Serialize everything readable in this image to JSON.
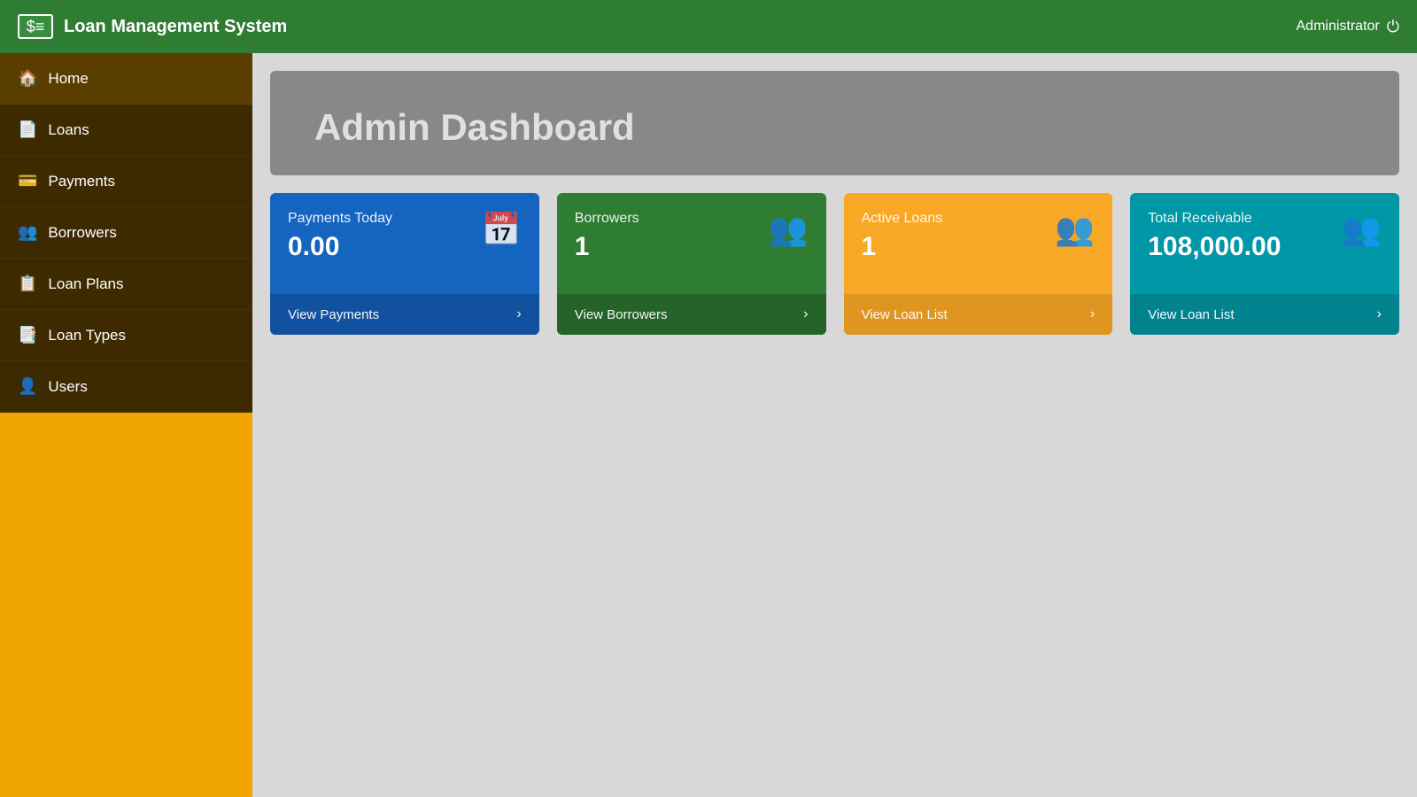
{
  "topnav": {
    "logo_text": "$≡",
    "app_title": "Loan Management System",
    "admin_label": "Administrator",
    "power_icon": "⏻"
  },
  "sidebar": {
    "items": [
      {
        "id": "home",
        "icon": "🏠",
        "label": "Home"
      },
      {
        "id": "loans",
        "icon": "📄",
        "label": "Loans"
      },
      {
        "id": "payments",
        "icon": "💳",
        "label": "Payments"
      },
      {
        "id": "borrowers",
        "icon": "👥",
        "label": "Borrowers"
      },
      {
        "id": "loan-plans",
        "icon": "📋",
        "label": "Loan Plans"
      },
      {
        "id": "loan-types",
        "icon": "📑",
        "label": "Loan Types"
      },
      {
        "id": "users",
        "icon": "👤",
        "label": "Users"
      }
    ]
  },
  "main": {
    "page_title": "Admin Dashboard",
    "cards": [
      {
        "id": "payments-today",
        "label": "Payments Today",
        "value": "0.00",
        "icon": "📅",
        "link_label": "View Payments",
        "color_class": "card-blue"
      },
      {
        "id": "borrowers",
        "label": "Borrowers",
        "value": "1",
        "icon": "👥",
        "link_label": "View Borrowers",
        "color_class": "card-green"
      },
      {
        "id": "active-loans",
        "label": "Active Loans",
        "value": "1",
        "icon": "👥",
        "link_label": "View Loan List",
        "color_class": "card-yellow"
      },
      {
        "id": "total-receivable",
        "label": "Total Receivable",
        "value": "108,000.00",
        "icon": "👥",
        "link_label": "View Loan List",
        "color_class": "card-teal"
      }
    ]
  }
}
